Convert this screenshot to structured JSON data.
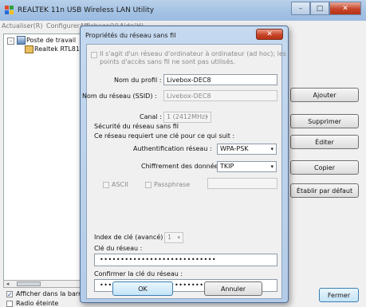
{
  "window": {
    "title": "REALTEK 11n USB Wireless LAN Utility",
    "minimize_glyph": "–",
    "maximize_glyph": "□",
    "close_glyph": "✕"
  },
  "menu": {
    "item1": "Actualiser(R)",
    "item2": "Configurer",
    "item3": "Affichage(V)",
    "item4": "Aide(H)"
  },
  "tree": {
    "toggle": "–",
    "root_label": "Poste de travail",
    "child_label": "Realtek RTL8191"
  },
  "bottom": {
    "show_in_bar_label": "Afficher dans la barre",
    "radio_off_label": "Radio éteinte",
    "show_in_bar_checked": "✓"
  },
  "side_buttons": {
    "add": "Ajouter",
    "remove": "Supprimer",
    "edit": "Éditer",
    "copy": "Copier",
    "default": "Établir par défaut",
    "close": "Fermer"
  },
  "dialog": {
    "title": "Propriétés du réseau sans fil",
    "close_glyph": "✕",
    "adhoc_line1": "Il s'agit d'un réseau d'ordinateur à ordinateur (ad hoc); les",
    "adhoc_line2": "points d'accès sans fil ne sont pas utilisés.",
    "profile_label": "Nom du profil :",
    "profile_value": "Livebox-DEC8",
    "ssid_label": "Nom du réseau (SSID) :",
    "ssid_value": "Livebox-DEC8",
    "channel_label": "Canal :",
    "channel_value": "1 (2412MHz)",
    "security_heading": "Sécurité du réseau sans fil",
    "key_required": "Ce réseau requiert une clé pour ce qui suit :",
    "auth_label": "Authentification réseau :",
    "auth_value": "WPA-PSK",
    "encryption_label": "Chiffrement des données :",
    "encryption_value": "TKIP",
    "ascii_label": "ASCII",
    "passphrase_label": "Passphrase",
    "key_index_label": "Index de clé (avancé) :",
    "key_index_value": "1",
    "network_key_label": "Clé du réseau :",
    "network_key_value": "••••••••••••••••••••••••••••",
    "confirm_key_label": "Confirmer la clé du réseau :",
    "confirm_key_value": "•••••••••••••••••••••••••••••••",
    "ok_label": "OK",
    "cancel_label": "Annuler",
    "caret": "▾"
  }
}
